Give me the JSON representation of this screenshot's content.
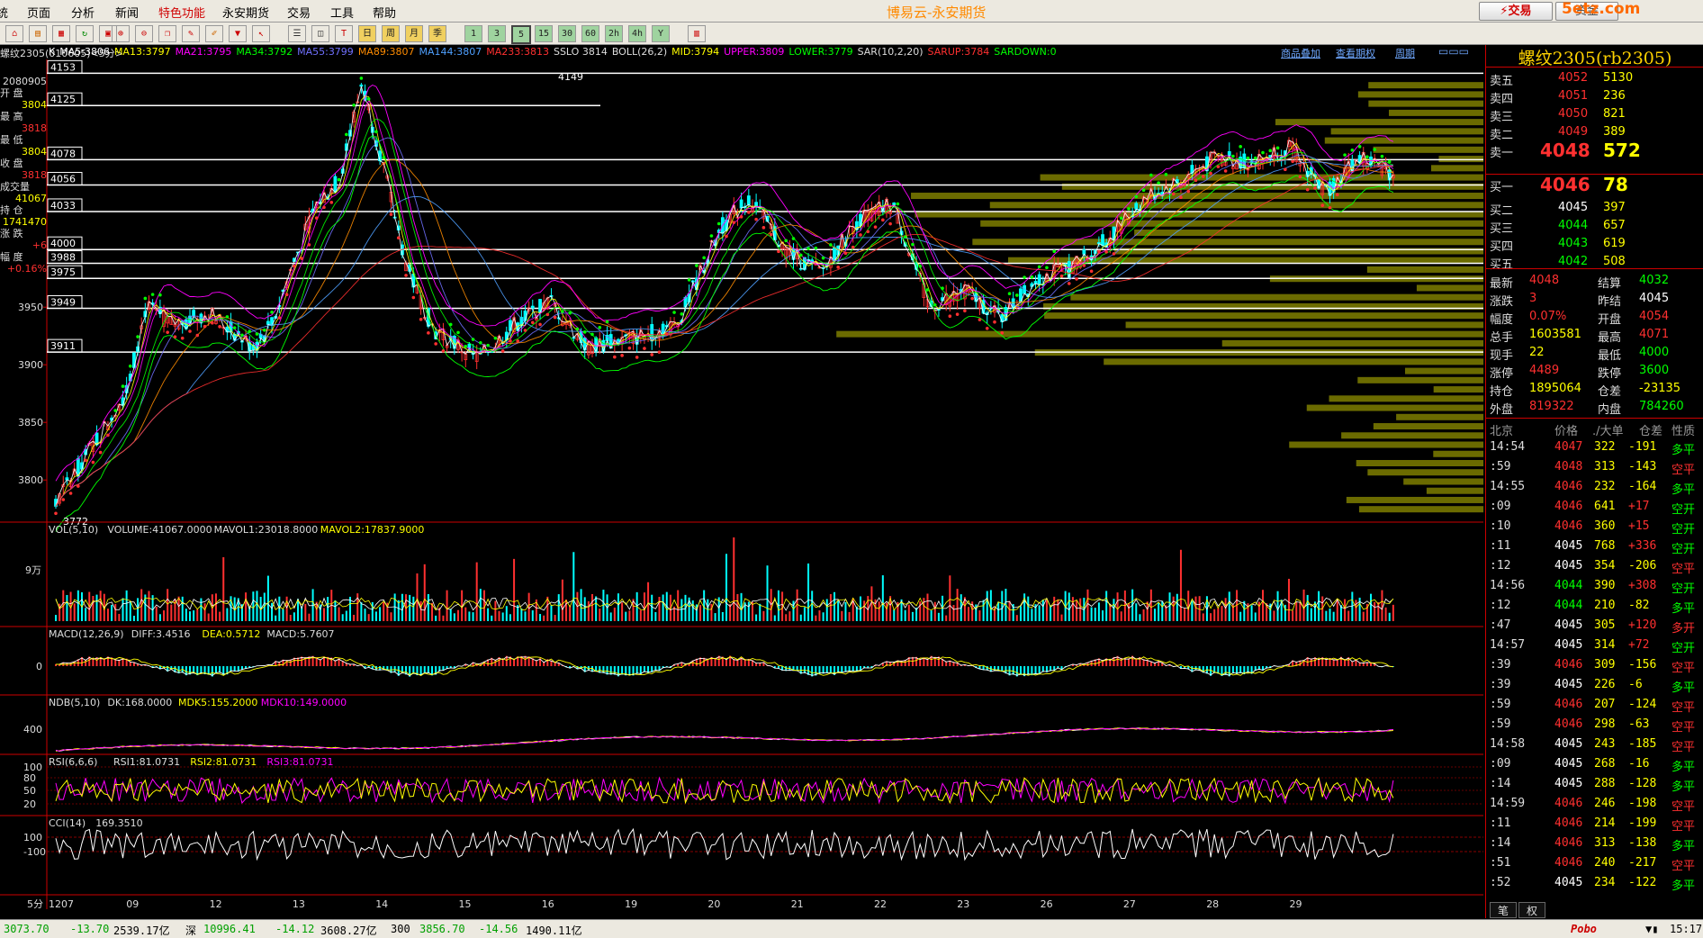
{
  "window": {
    "title": "博易云-永安期货"
  },
  "menu": {
    "items": [
      "统",
      "页面",
      "分析",
      "新闻",
      "特色功能",
      "永安期货",
      "交易",
      "工具",
      "帮助"
    ],
    "active": "特色功能"
  },
  "buttons": {
    "trade": "⚡交易",
    "asset": "资金"
  },
  "watermark": "5etz.com",
  "toolbar": {
    "periods": [
      "日",
      "周",
      "月",
      "季",
      "1",
      "3",
      "5",
      "15",
      "30",
      "60",
      "2h",
      "4h",
      "Y"
    ],
    "selected": "5"
  },
  "chart": {
    "symbol_header": "螺纹2305(010605)<5分>",
    "indicators": [
      {
        "text": "K",
        "color": "#ffffff"
      },
      {
        "text": "MA5:3806",
        "color": "#ffffff"
      },
      {
        "text": "MA13:3797",
        "color": "#ffff00"
      },
      {
        "text": "MA21:3795",
        "color": "#ff00ff"
      },
      {
        "text": "MA34:3792",
        "color": "#00ff00"
      },
      {
        "text": "MA55:3799",
        "color": "#7070ff"
      },
      {
        "text": "MA89:3807",
        "color": "#ff8c00"
      },
      {
        "text": "MA144:3807",
        "color": "#4fa0ff"
      },
      {
        "text": "MA233:3813",
        "color": "#ff3030"
      },
      {
        "text": "SSLO 3814",
        "color": "#dddddd"
      },
      {
        "text": "BOLL(26,2)",
        "color": "#dddddd"
      },
      {
        "text": "MID:3794",
        "color": "#ffff00"
      },
      {
        "text": "UPPER:3809",
        "color": "#ff00ff"
      },
      {
        "text": "LOWER:3779",
        "color": "#00ff00"
      },
      {
        "text": "SAR(10,2,20)",
        "color": "#dddddd"
      },
      {
        "text": "SARUP:3784",
        "color": "#ff3030"
      },
      {
        "text": "SARDOWN:0",
        "color": "#00ff00"
      }
    ],
    "links": [
      "商品叠加",
      "查看期权",
      "周期"
    ],
    "ohlc_panel": {
      "date": "2080905",
      "open_label": "开 盘",
      "open": "3804",
      "high_label": "最 高",
      "high": "3818",
      "low_label": "最 低",
      "low": "3804",
      "close_label": "收 盘",
      "close": "3818",
      "volume_label": "成交量",
      "volume": "41067",
      "oi_label": "持 仓",
      "oi": "1741470",
      "chg_label": "涨 跌",
      "chg": "+6",
      "pct_label": "幅 度",
      "pct": "+0.16%"
    },
    "price_axis": [
      "3950",
      "3900",
      "3850",
      "3800"
    ],
    "level_boxes": [
      "4153",
      "4125",
      "4078",
      "4056",
      "4033",
      "4000",
      "3988",
      "3975",
      "3949",
      "3911"
    ],
    "high_marker": "4149",
    "low_marker": "3772",
    "colors": {
      "up": "#ff3030",
      "down": "#00ffff",
      "volume_profile": "#6b6b00",
      "separator": "#cc0000"
    }
  },
  "sub_charts": [
    {
      "header": [
        {
          "text": "VOL(5,10)",
          "color": "#dddddd"
        },
        {
          "text": "VOLUME:41067.0000",
          "color": "#dddddd"
        },
        {
          "text": "MAVOL1:23018.8000",
          "color": "#dddddd"
        },
        {
          "text": "MAVOL2:17837.9000",
          "color": "#ffff00"
        }
      ],
      "axis": [
        "9万"
      ]
    },
    {
      "header": [
        {
          "text": "MACD(12,26,9)",
          "color": "#dddddd"
        },
        {
          "text": "DIFF:3.4516",
          "color": "#dddddd"
        },
        {
          "text": "DEA:0.5712",
          "color": "#ffff00"
        },
        {
          "text": "MACD:5.7607",
          "color": "#dddddd"
        }
      ],
      "axis": [
        "0"
      ]
    },
    {
      "header": [
        {
          "text": "NDB(5,10)",
          "color": "#dddddd"
        },
        {
          "text": "DK:168.0000",
          "color": "#dddddd"
        },
        {
          "text": "MDK5:155.2000",
          "color": "#ffff00"
        },
        {
          "text": "MDK10:149.0000",
          "color": "#ff00ff"
        }
      ],
      "axis": [
        "400"
      ]
    },
    {
      "header": [
        {
          "text": "RSI(6,6,6)",
          "color": "#dddddd"
        },
        {
          "text": "RSI1:81.0731",
          "color": "#dddddd"
        },
        {
          "text": "RSI2:81.0731",
          "color": "#ffff00"
        },
        {
          "text": "RSI3:81.0731",
          "color": "#ff00ff"
        }
      ],
      "axis": [
        "100",
        "80",
        "50",
        "20"
      ]
    },
    {
      "header": [
        {
          "text": "CCI(14)",
          "color": "#dddddd"
        },
        {
          "text": "169.3510",
          "color": "#dddddd"
        }
      ],
      "axis": [
        "100",
        "-100"
      ]
    }
  ],
  "x_axis": {
    "period": "5分",
    "labels": [
      "1207",
      "09",
      "12",
      "13",
      "14",
      "15",
      "16",
      "19",
      "20",
      "21",
      "22",
      "23",
      "26",
      "27",
      "28",
      "29"
    ]
  },
  "quote": {
    "title": "螺纹2305(rb2305)",
    "asks": [
      {
        "label": "卖五",
        "price": "4052",
        "vol": "5130"
      },
      {
        "label": "卖四",
        "price": "4051",
        "vol": "236"
      },
      {
        "label": "卖三",
        "price": "4050",
        "vol": "821"
      },
      {
        "label": "卖二",
        "price": "4049",
        "vol": "389"
      },
      {
        "label": "卖一",
        "price": "4048",
        "vol": "572"
      }
    ],
    "bids": [
      {
        "label": "买一",
        "price": "4046",
        "vol": "78"
      },
      {
        "label": "买二",
        "price": "4045",
        "vol": "397"
      },
      {
        "label": "买三",
        "price": "4044",
        "vol": "657"
      },
      {
        "label": "买四",
        "price": "4043",
        "vol": "619"
      },
      {
        "label": "买五",
        "price": "4042",
        "vol": "508"
      }
    ],
    "stats": [
      {
        "l1": "最新",
        "v1": "4048",
        "c1": "#ff3030",
        "l2": "结算",
        "v2": "4032",
        "c2": "#00ff00"
      },
      {
        "l1": "涨跌",
        "v1": "3",
        "c1": "#ff3030",
        "l2": "昨结",
        "v2": "4045",
        "c2": "#ffffff"
      },
      {
        "l1": "幅度",
        "v1": "0.07%",
        "c1": "#ff3030",
        "l2": "开盘",
        "v2": "4054",
        "c2": "#ff3030"
      },
      {
        "l1": "总手",
        "v1": "1603581",
        "c1": "#ffff00",
        "l2": "最高",
        "v2": "4071",
        "c2": "#ff3030"
      },
      {
        "l1": "现手",
        "v1": "22",
        "c1": "#ffff00",
        "l2": "最低",
        "v2": "4000",
        "c2": "#00ff00"
      },
      {
        "l1": "涨停",
        "v1": "4489",
        "c1": "#ff3030",
        "l2": "跌停",
        "v2": "3600",
        "c2": "#00ff00"
      },
      {
        "l1": "持仓",
        "v1": "1895064",
        "c1": "#ffff00",
        "l2": "仓差",
        "v2": "-23135",
        "c2": "#ffff00"
      },
      {
        "l1": "外盘",
        "v1": "819322",
        "c1": "#ff3030",
        "l2": "内盘",
        "v2": "784260",
        "c2": "#00ff00"
      }
    ],
    "tick_header": [
      "北京",
      "价格",
      "./大单",
      "仓差",
      "性质"
    ],
    "ticks": [
      {
        "t": "14:54",
        "p": "4047",
        "pc": "#ff3030",
        "v": "322",
        "d": "-191",
        "nat": "多平",
        "nc": "#00ff00"
      },
      {
        "t": ":59",
        "p": "4048",
        "pc": "#ff3030",
        "v": "313",
        "d": "-143",
        "nat": "空平",
        "nc": "#ff3030"
      },
      {
        "t": "14:55",
        "p": "4046",
        "pc": "#ff3030",
        "v": "232",
        "d": "-164",
        "nat": "多平",
        "nc": "#00ff00"
      },
      {
        "t": ":09",
        "p": "4046",
        "pc": "#ff3030",
        "v": "641",
        "d": "+17",
        "nat": "空开",
        "nc": "#00ff00"
      },
      {
        "t": ":10",
        "p": "4046",
        "pc": "#ff3030",
        "v": "360",
        "d": "+15",
        "nat": "空开",
        "nc": "#00ff00"
      },
      {
        "t": ":11",
        "p": "4045",
        "pc": "#ffffff",
        "v": "768",
        "d": "+336",
        "nat": "空开",
        "nc": "#00ff00"
      },
      {
        "t": ":12",
        "p": "4045",
        "pc": "#ffffff",
        "v": "354",
        "d": "-206",
        "nat": "空平",
        "nc": "#ff3030"
      },
      {
        "t": "14:56",
        "p": "4044",
        "pc": "#00ff00",
        "v": "390",
        "d": "+308",
        "nat": "空开",
        "nc": "#00ff00"
      },
      {
        "t": ":12",
        "p": "4044",
        "pc": "#00ff00",
        "v": "210",
        "d": "-82",
        "nat": "多平",
        "nc": "#00ff00"
      },
      {
        "t": ":47",
        "p": "4045",
        "pc": "#ffffff",
        "v": "305",
        "d": "+120",
        "nat": "多开",
        "nc": "#ff3030"
      },
      {
        "t": "14:57",
        "p": "4045",
        "pc": "#ffffff",
        "v": "314",
        "d": "+72",
        "nat": "空开",
        "nc": "#00ff00"
      },
      {
        "t": ":39",
        "p": "4046",
        "pc": "#ff3030",
        "v": "309",
        "d": "-156",
        "nat": "空平",
        "nc": "#ff3030"
      },
      {
        "t": ":39",
        "p": "4045",
        "pc": "#ffffff",
        "v": "226",
        "d": "-6",
        "nat": "多平",
        "nc": "#00ff00"
      },
      {
        "t": ":59",
        "p": "4046",
        "pc": "#ff3030",
        "v": "207",
        "d": "-124",
        "nat": "空平",
        "nc": "#ff3030"
      },
      {
        "t": ":59",
        "p": "4046",
        "pc": "#ff3030",
        "v": "298",
        "d": "-63",
        "nat": "空平",
        "nc": "#ff3030"
      },
      {
        "t": "14:58",
        "p": "4045",
        "pc": "#ffffff",
        "v": "243",
        "d": "-185",
        "nat": "空平",
        "nc": "#ff3030"
      },
      {
        "t": ":09",
        "p": "4045",
        "pc": "#ffffff",
        "v": "268",
        "d": "-16",
        "nat": "多平",
        "nc": "#00ff00"
      },
      {
        "t": ":14",
        "p": "4045",
        "pc": "#ffffff",
        "v": "288",
        "d": "-128",
        "nat": "多平",
        "nc": "#00ff00"
      },
      {
        "t": "14:59",
        "p": "4046",
        "pc": "#ff3030",
        "v": "246",
        "d": "-198",
        "nat": "空平",
        "nc": "#ff3030"
      },
      {
        "t": ":11",
        "p": "4046",
        "pc": "#ff3030",
        "v": "214",
        "d": "-199",
        "nat": "空平",
        "nc": "#ff3030"
      },
      {
        "t": ":14",
        "p": "4046",
        "pc": "#ff3030",
        "v": "313",
        "d": "-138",
        "nat": "多平",
        "nc": "#00ff00"
      },
      {
        "t": ":51",
        "p": "4046",
        "pc": "#ff3030",
        "v": "240",
        "d": "-217",
        "nat": "空平",
        "nc": "#ff3030"
      },
      {
        "t": ":52",
        "p": "4045",
        "pc": "#ffffff",
        "v": "234",
        "d": "-122",
        "nat": "多平",
        "nc": "#00ff00"
      }
    ],
    "tabs": [
      "笔",
      "权"
    ]
  },
  "status": {
    "idx1_value": "3073.70",
    "idx1_chg": "-13.70",
    "idx1_amt": "2539.17亿",
    "idx2_name": "深",
    "idx2_value": "10996.41",
    "idx2_chg": "-14.12",
    "idx2_amt": "3608.27亿",
    "idx3_name": "300",
    "idx3_value": "3856.70",
    "idx3_chg": "-14.56",
    "idx3_amt": "1490.11亿",
    "brand": "Pobo",
    "time": "15:17"
  }
}
